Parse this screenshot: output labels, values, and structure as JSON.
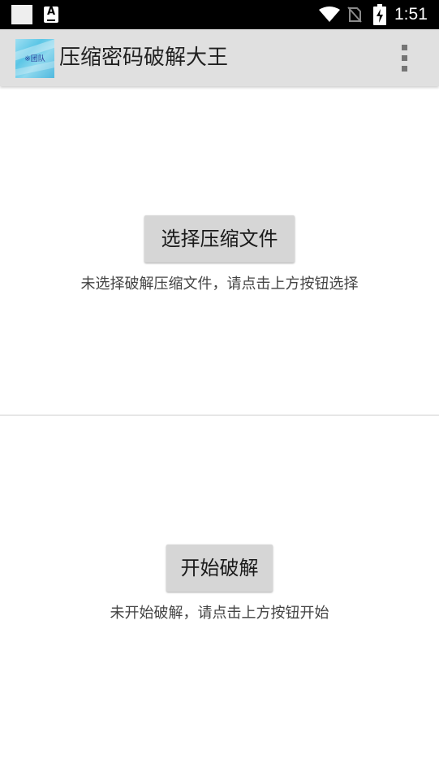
{
  "status_bar": {
    "time": "1:51",
    "icons": [
      "notification-square-icon",
      "notification-a-icon",
      "wifi-icon",
      "no-sim-icon",
      "battery-charging-icon"
    ],
    "notification_letter": "A"
  },
  "app_bar": {
    "logo_text": "※团队",
    "title": "压缩密码破解大王",
    "menu_icon": "overflow-menu-icon"
  },
  "file_section": {
    "button_label": "选择压缩文件",
    "hint": "未选择破解压缩文件，请点击上方按钮选择"
  },
  "crack_section": {
    "button_label": "开始破解",
    "hint": "未开始破解，请点击上方按钮开始"
  },
  "colors": {
    "status_bar_bg": "#000000",
    "app_bar_bg": "#e0e0e0",
    "button_bg": "#d6d6d6",
    "hint_text": "#444444"
  }
}
